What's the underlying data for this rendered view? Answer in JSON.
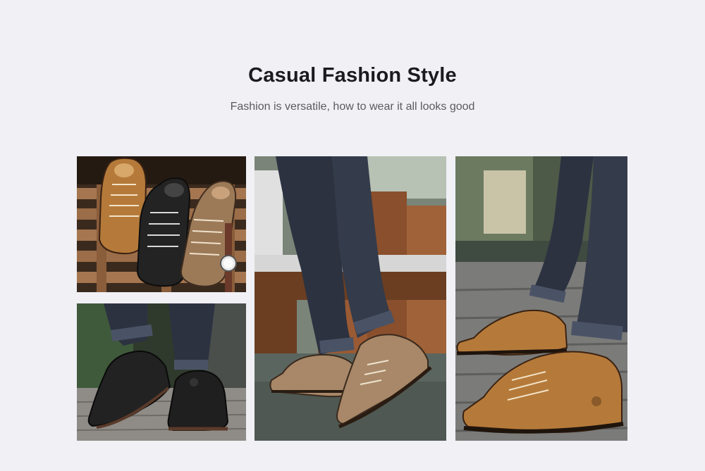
{
  "section": {
    "title": "Casual Fashion Style",
    "subtitle": "Fashion is versatile, how to wear it all looks good"
  },
  "photos": [
    {
      "name": "three-shoes-on-pallet",
      "subject": "brown, black and khaki lace-up boots on wooden pallet with wristwatch"
    },
    {
      "name": "black-shoes-walking",
      "subject": "black lace-up shoes with ripped jeans walking"
    },
    {
      "name": "khaki-shoes-walking",
      "subject": "khaki lace-up shoes with ripped jeans walking near benches"
    },
    {
      "name": "brown-shoes-walking",
      "subject": "brown lace-up shoes with ripped jeans on wooden deck"
    }
  ],
  "colors": {
    "background": "#f0f0f5",
    "title": "#1b1b1f",
    "subtitle": "#5a5a60",
    "leather_brown": "#b57a3a",
    "leather_khaki": "#9c7a58",
    "leather_black": "#222222",
    "denim": "#2c3240"
  }
}
